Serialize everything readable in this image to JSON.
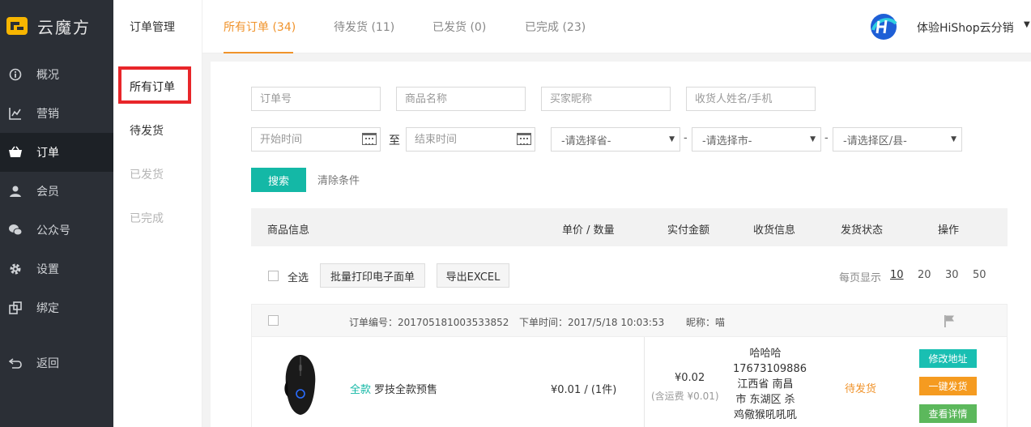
{
  "brand": {
    "name": "云魔方"
  },
  "sidebar": {
    "items": [
      {
        "label": "概况",
        "icon": "info-icon"
      },
      {
        "label": "营销",
        "icon": "chart-icon"
      },
      {
        "label": "订单",
        "icon": "basket-icon"
      },
      {
        "label": "会员",
        "icon": "user-icon"
      },
      {
        "label": "公众号",
        "icon": "wechat-icon"
      },
      {
        "label": "设置",
        "icon": "gear-icon"
      },
      {
        "label": "绑定",
        "icon": "link-icon"
      },
      {
        "label": "返回",
        "icon": "return-icon"
      }
    ],
    "active": "订单"
  },
  "submenu": {
    "title": "订单管理",
    "items": [
      {
        "label": "所有订单"
      },
      {
        "label": "待发货"
      },
      {
        "label": "已发货"
      },
      {
        "label": "已完成"
      }
    ]
  },
  "header": {
    "tabs": [
      {
        "label": "所有订单 (34)"
      },
      {
        "label": "待发货 (11)"
      },
      {
        "label": "已发货 (0)"
      },
      {
        "label": "已完成 (23)"
      }
    ],
    "user_name": "体验HiShop云分销"
  },
  "filters": {
    "order_no_placeholder": "订单号",
    "product_name_placeholder": "商品名称",
    "buyer_nick_placeholder": "买家昵称",
    "receiver_placeholder": "收货人姓名/手机",
    "start_time_placeholder": "开始时间",
    "end_time_placeholder": "结束时间",
    "to_label": "至",
    "province": "-请选择省-",
    "city": "-请选择市-",
    "district": "-请选择区/县-",
    "dash": "-",
    "search_label": "搜索",
    "clear_label": "清除条件"
  },
  "table": {
    "headers": [
      "商品信息",
      "单价 / 数量",
      "实付金额",
      "收货信息",
      "发货状态",
      "操作"
    ],
    "select_all_label": "全选",
    "batch_print_label": "批量打印电子面单",
    "export_label": "导出EXCEL",
    "per_page_label": "每页显示",
    "per_page_options": [
      "10",
      "20",
      "30",
      "50"
    ]
  },
  "order": {
    "order_no": "订单编号：201705181003533852",
    "order_time": "下单时间：2017/5/18 10:03:53",
    "nickname": "昵称：喵",
    "tag": "全款",
    "product_name": "罗技全款预售",
    "price_qty": "¥0.01 / (1件)",
    "paid": "¥0.02",
    "paid_note": "(含运费 ¥0.01)",
    "receiver_name": "哈哈哈",
    "receiver_phone": "17673109886",
    "receiver_address": "江西省 南昌市 东湖区 杀鸡儆猴吼吼吼",
    "status": "待发货",
    "actions": [
      "修改地址",
      "一键发货",
      "查看详情"
    ]
  },
  "colors": {
    "accent": "#14b8a6",
    "orange": "#f0932b",
    "highlight_box": "#e8262a",
    "sidebar_bg": "#2b2f36"
  }
}
